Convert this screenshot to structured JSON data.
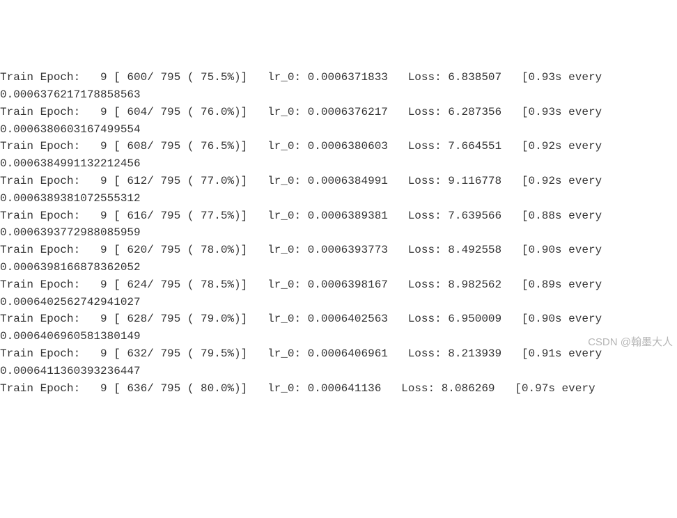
{
  "log": {
    "entries": [
      {
        "epoch": 9,
        "step": 600,
        "total": 795,
        "pct": "75.5%",
        "lr": "0.0006371833",
        "loss": "6.838507",
        "sec": "0.93s",
        "next_lr": "0.0006376217178858563"
      },
      {
        "epoch": 9,
        "step": 604,
        "total": 795,
        "pct": "76.0%",
        "lr": "0.0006376217",
        "loss": "6.287356",
        "sec": "0.93s",
        "next_lr": "0.0006380603167499554"
      },
      {
        "epoch": 9,
        "step": 608,
        "total": 795,
        "pct": "76.5%",
        "lr": "0.0006380603",
        "loss": "7.664551",
        "sec": "0.92s",
        "next_lr": "0.0006384991132212456"
      },
      {
        "epoch": 9,
        "step": 612,
        "total": 795,
        "pct": "77.0%",
        "lr": "0.0006384991",
        "loss": "9.116778",
        "sec": "0.92s",
        "next_lr": "0.0006389381072555312"
      },
      {
        "epoch": 9,
        "step": 616,
        "total": 795,
        "pct": "77.5%",
        "lr": "0.0006389381",
        "loss": "7.639566",
        "sec": "0.88s",
        "next_lr": "0.0006393772988085959"
      },
      {
        "epoch": 9,
        "step": 620,
        "total": 795,
        "pct": "78.0%",
        "lr": "0.0006393773",
        "loss": "8.492558",
        "sec": "0.90s",
        "next_lr": "0.0006398166878362052"
      },
      {
        "epoch": 9,
        "step": 624,
        "total": 795,
        "pct": "78.5%",
        "lr": "0.0006398167",
        "loss": "8.982562",
        "sec": "0.89s",
        "next_lr": "0.0006402562742941027"
      },
      {
        "epoch": 9,
        "step": 628,
        "total": 795,
        "pct": "79.0%",
        "lr": "0.0006402563",
        "loss": "6.950009",
        "sec": "0.90s",
        "next_lr": "0.0006406960581380149"
      },
      {
        "epoch": 9,
        "step": 632,
        "total": 795,
        "pct": "79.5%",
        "lr": "0.0006406961",
        "loss": "8.213939",
        "sec": "0.91s",
        "next_lr": "0.0006411360393236447"
      },
      {
        "epoch": 9,
        "step": 636,
        "total": 795,
        "pct": "80.0%",
        "lr": "0.000641136",
        "loss": "8.086269",
        "sec": "0.97s",
        "next_lr": ""
      }
    ]
  },
  "watermark": "CSDN @翰墨大人"
}
